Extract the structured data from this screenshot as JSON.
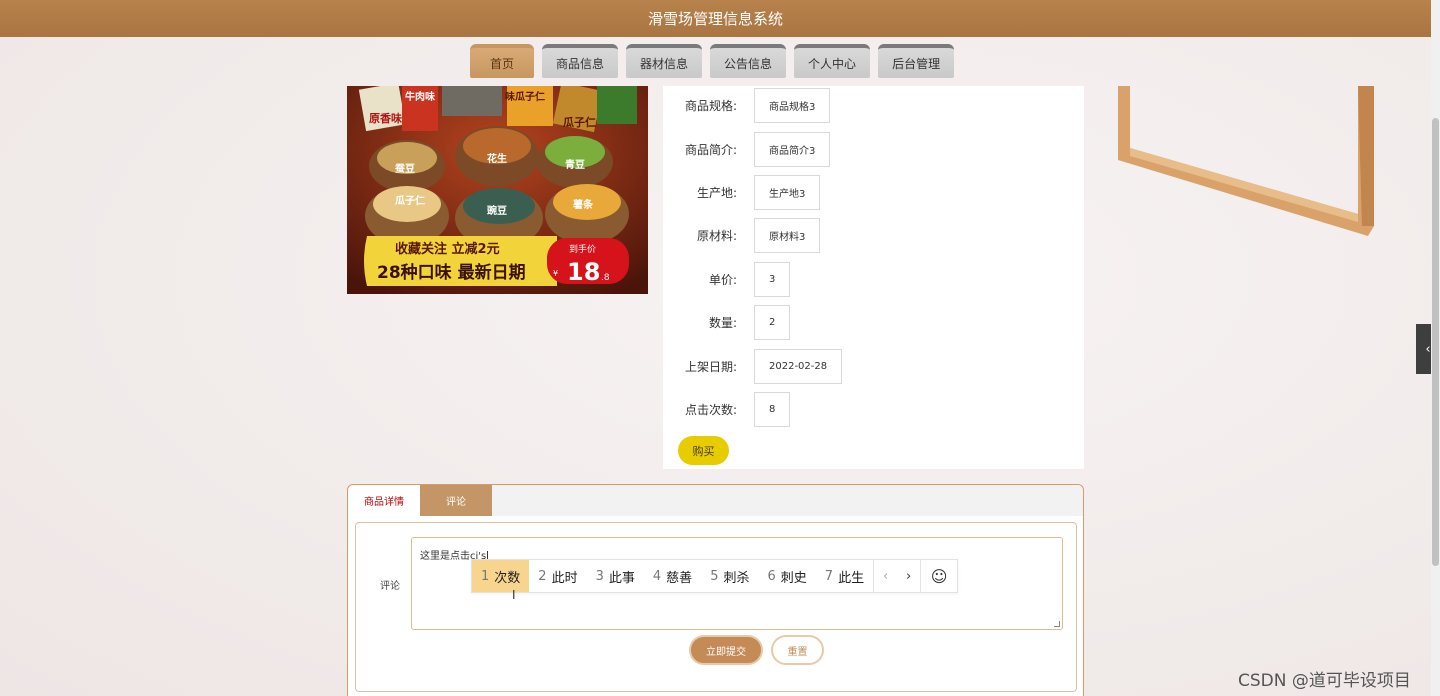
{
  "app": {
    "title": "滑雪场管理信息系统"
  },
  "nav": {
    "items": [
      {
        "label": "首页",
        "active": true
      },
      {
        "label": "商品信息"
      },
      {
        "label": "器材信息"
      },
      {
        "label": "公告信息"
      },
      {
        "label": "个人中心"
      },
      {
        "label": "后台管理"
      }
    ]
  },
  "product": {
    "image": {
      "banner_top_left": "收藏关注 立减2元",
      "banner_bottom": "28种口味 最新日期",
      "price_tag_label": "到手价",
      "price_tag_currency": "¥",
      "price_tag_value": "18",
      "price_tag_decimal": ".8",
      "bag_labels": [
        "蚕豆",
        "花生",
        "青豆",
        "瓜子仁",
        "豌豆",
        "薯条"
      ],
      "top_labels": [
        "原香味",
        "牛肉味",
        "味瓜子仁",
        "瓜子仁"
      ]
    },
    "fields": [
      {
        "label": "商品规格:",
        "value": "商品规格3"
      },
      {
        "label": "商品简介:",
        "value": "商品简介3"
      },
      {
        "label": "生产地:",
        "value": "生产地3"
      },
      {
        "label": "原材料:",
        "value": "原材料3"
      },
      {
        "label": "单价:",
        "value": "3"
      },
      {
        "label": "数量:",
        "value": "2"
      },
      {
        "label": "上架日期:",
        "value": "2022-02-28"
      },
      {
        "label": "点击次数:",
        "value": "8"
      }
    ],
    "buy_label": "购买"
  },
  "tabs": {
    "items": [
      {
        "label": "商品详情"
      },
      {
        "label": "评论"
      }
    ]
  },
  "comment": {
    "label": "评论",
    "typed_text": "这里是点击ci's",
    "ime_candidates": [
      {
        "num": "1",
        "text": "次数"
      },
      {
        "num": "2",
        "text": "此时"
      },
      {
        "num": "3",
        "text": "此事"
      },
      {
        "num": "4",
        "text": "慈善"
      },
      {
        "num": "5",
        "text": "刺杀"
      },
      {
        "num": "6",
        "text": "刺史"
      },
      {
        "num": "7",
        "text": "此生"
      }
    ],
    "ime_prev_icon": "‹",
    "ime_next_icon": "›",
    "ime_emoji_icon": "☺",
    "submit_label": "立即提交",
    "reset_label": "重置"
  },
  "side_handle_icon": "‹",
  "watermark": "CSDN @道可毕设项目"
}
